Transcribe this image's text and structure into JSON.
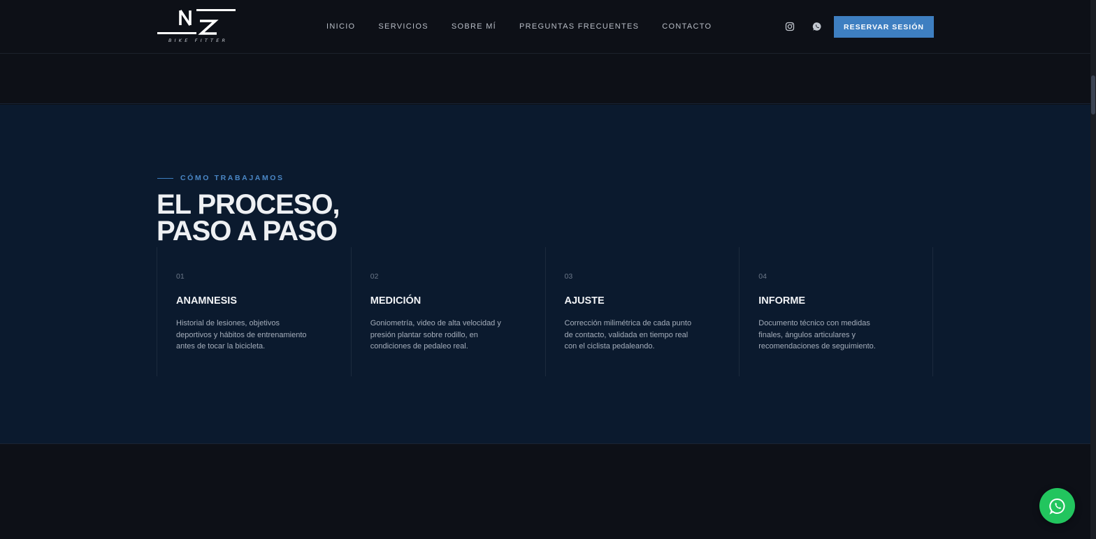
{
  "brand": {
    "logo_letters": "NZ",
    "logo_subtitle": "BIKE FITTER"
  },
  "nav": {
    "items": [
      {
        "label": "INICIO"
      },
      {
        "label": "SERVICIOS"
      },
      {
        "label": "SOBRE MÍ"
      },
      {
        "label": "PREGUNTAS FRECUENTES"
      },
      {
        "label": "CONTACTO"
      }
    ]
  },
  "header_actions": {
    "icons": [
      "instagram-icon",
      "whatsapp-icon"
    ],
    "cta_label": "RESERVAR SESIÓN"
  },
  "process": {
    "eyebrow": "CÓMO TRABAJAMOS",
    "title_line1": "EL PROCESO,",
    "title_line2": "PASO A PASO",
    "steps": [
      {
        "number": "01",
        "title": "ANAMNESIS",
        "text": "Historial de lesiones, objetivos deportivos y hábitos de entrenamiento antes de tocar la bicicleta."
      },
      {
        "number": "02",
        "title": "MEDICIÓN",
        "text": "Goniometría, video de alta velocidad y presión plantar sobre rodillo, en condiciones de pedaleo real."
      },
      {
        "number": "03",
        "title": "AJUSTE",
        "text": "Corrección milimétrica de cada punto de contacto, validada en tiempo real con el ciclista pedaleando."
      },
      {
        "number": "04",
        "title": "INFORME",
        "text": "Documento técnico con medidas finales, ángulos articulares y recomendaciones de seguimiento."
      }
    ]
  },
  "floating": {
    "icon": "whatsapp-icon"
  },
  "colors": {
    "background": "#0d1017",
    "section_background": "#0b1a2e",
    "accent": "#3e7fc1",
    "whatsapp": "#22c55e"
  }
}
